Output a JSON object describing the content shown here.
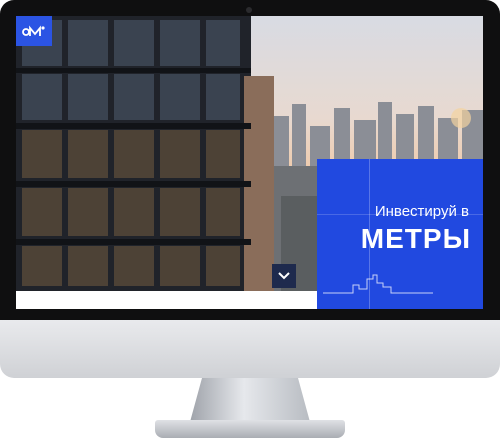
{
  "hero": {
    "cta_subtitle": "Инвестируй в",
    "cta_title": "МЕТРЫ"
  },
  "icons": {
    "logo": "brand-logo-icon",
    "scroll": "chevron-down-icon",
    "skyline": "city-skyline-icon"
  },
  "colors": {
    "brand_blue": "#2149e0",
    "logo_blue": "#2b54e4",
    "scroll_button": "#1e2a4d",
    "monitor_bezel": "#0f0f10"
  }
}
